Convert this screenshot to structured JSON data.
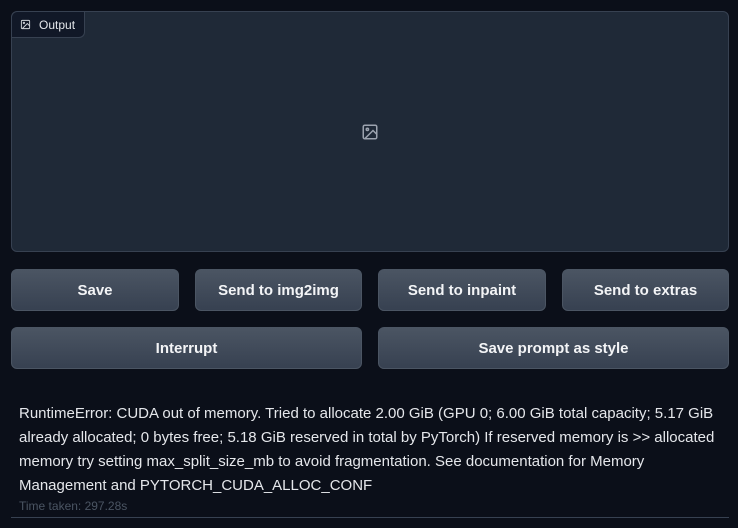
{
  "output": {
    "label": "Output",
    "label_icon": "image-icon",
    "placeholder_icon": "image-icon"
  },
  "buttons": {
    "save": "Save",
    "send_img2img": "Send to img2img",
    "send_inpaint": "Send to inpaint",
    "send_extras": "Send to extras",
    "interrupt": "Interrupt",
    "save_prompt_style": "Save prompt as style"
  },
  "error": {
    "message": "RuntimeError: CUDA out of memory. Tried to allocate 2.00 GiB (GPU 0; 6.00 GiB total capacity; 5.17 GiB already allocated; 0 bytes free; 5.18 GiB reserved in total by PyTorch) If reserved memory is >> allocated memory try setting max_split_size_mb to avoid fragmentation. See documentation for Memory Management and PYTORCH_CUDA_ALLOC_CONF"
  },
  "time_taken": "Time taken: 297.28s",
  "colors": {
    "background": "#0b0f19",
    "panel": "#1f2937",
    "button": "#374151",
    "text": "#e5e7eb"
  }
}
